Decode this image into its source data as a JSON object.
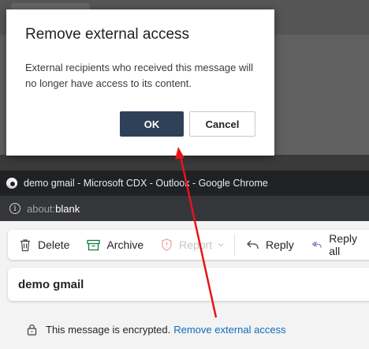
{
  "dialog": {
    "title": "Remove external access",
    "body": "External recipients who received this message will no longer have access to its content.",
    "ok_label": "OK",
    "cancel_label": "Cancel"
  },
  "browser": {
    "window_title": "demo gmail - Microsoft CDX - Outlook - Google Chrome",
    "url_scheme": "about:",
    "url_host": "blank"
  },
  "toolbar": {
    "delete_label": "Delete",
    "archive_label": "Archive",
    "report_label": "Report",
    "reply_label": "Reply",
    "reply_all_label": "Reply all"
  },
  "message": {
    "subject": "demo gmail",
    "encryption_text": "This message is encrypted.",
    "remove_access_link": "Remove external access"
  },
  "colors": {
    "ok_button": "#2f4158",
    "link": "#0f6cbd",
    "annotation_arrow": "#e8141b",
    "archive_icon": "#107c41"
  }
}
